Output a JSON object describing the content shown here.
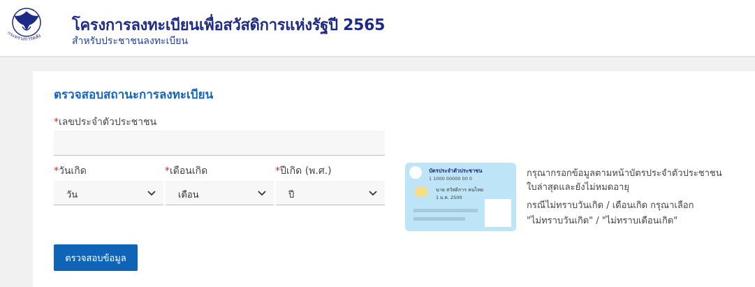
{
  "header": {
    "title": "โครงการลงทะเบียนเพื่อสวัสดิการแห่งรัฐปี 2565",
    "subtitle": "สำหรับประชาชนลงทะเบียน",
    "logo_text": "กระทรวงการคลัง"
  },
  "form": {
    "title": "ตรวจสอบสถานะการลงทะเบียน",
    "id_label": "เลขประจำตัวประชาชน",
    "id_value": "",
    "required_mark": "*",
    "day_label": "วันเกิด",
    "month_label": "เดือนเกิด",
    "year_label": "ปีเกิด (พ.ศ.)",
    "day_selected": "วัน",
    "month_selected": "เดือน",
    "year_selected": "ปี",
    "submit_label": "ตรวจสอบข้อมูล"
  },
  "id_card": {
    "title": "บัตรประจำตัวประชาชน",
    "number": "1 1000 00000 00 0",
    "name": "นาย สวัสดิการ คนไทย",
    "dob": "1 ม.ค. 2500"
  },
  "help": {
    "line1": "กรุณากรอกข้อมูลตามหน้าบัตรประจำตัวประชาชน",
    "line2": "ใบล่าสุดและยังไม่หมดอายุ",
    "line3": "กรณีไม่ทราบวันเกิด / เดือนเกิด กรุณาเลือก",
    "line4": "\"ไม่ทราบวันเกิด\" / \"ไม่ทราบเดือนเกิด\""
  },
  "colors": {
    "title": "#1e2b86",
    "accent": "#1565c0",
    "button": "#0f64b8",
    "required": "#d32f2f",
    "card_bg": "#bde5f7"
  },
  "icons": {
    "logo": "garuda-emblem-icon",
    "dropdown": "chevron-down-icon"
  }
}
